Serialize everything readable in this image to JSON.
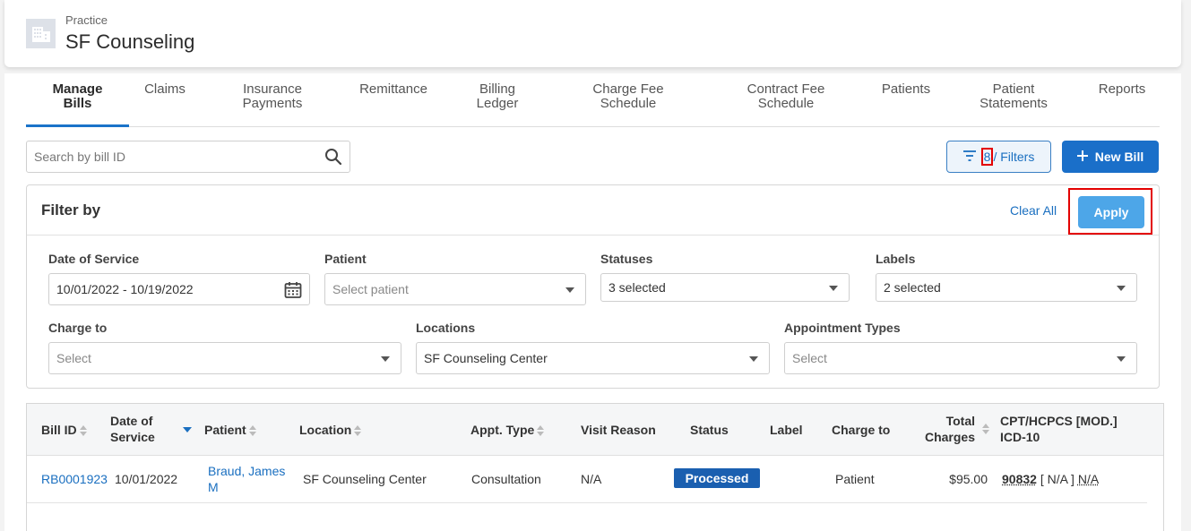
{
  "header": {
    "practice_label": "Practice",
    "practice_name": "SF Counseling"
  },
  "tabs": [
    {
      "line1": "Manage",
      "line2": "Bills"
    },
    {
      "line1": "Claims",
      "line2": ""
    },
    {
      "line1": "Insurance",
      "line2": "Payments"
    },
    {
      "line1": "Remittance",
      "line2": ""
    },
    {
      "line1": "Billing",
      "line2": "Ledger"
    },
    {
      "line1": "Charge Fee",
      "line2": "Schedule"
    },
    {
      "line1": "Contract Fee",
      "line2": "Schedule"
    },
    {
      "line1": "Patients",
      "line2": ""
    },
    {
      "line1": "Patient",
      "line2": "Statements"
    },
    {
      "line1": "Reports",
      "line2": ""
    }
  ],
  "search": {
    "placeholder": "Search by bill ID"
  },
  "toolbar": {
    "filter_count": "8",
    "filters_label": "/ Filters",
    "new_bill_label": "New Bill"
  },
  "filter_panel": {
    "title": "Filter by",
    "clear_all": "Clear All",
    "apply": "Apply",
    "date_of_service": {
      "label": "Date of Service",
      "value": "10/01/2022 - 10/19/2022"
    },
    "patient": {
      "label": "Patient",
      "value": "Select patient"
    },
    "statuses": {
      "label": "Statuses",
      "value": "3 selected"
    },
    "labels": {
      "label": "Labels",
      "value": "2 selected"
    },
    "charge_to": {
      "label": "Charge to",
      "value": "Select"
    },
    "locations": {
      "label": "Locations",
      "value": "SF Counseling Center"
    },
    "appointment_types": {
      "label": "Appointment Types",
      "value": "Select"
    }
  },
  "table": {
    "headers": {
      "bill_id": "Bill ID",
      "date_line1": "Date of",
      "date_line2": "Service",
      "patient": "Patient",
      "location": "Location",
      "appt_type": "Appt. Type",
      "visit_reason": "Visit Reason",
      "status": "Status",
      "label": "Label",
      "charge_to": "Charge to",
      "total_line1": "Total",
      "total_line2": "Charges",
      "cpt_line1": "CPT/HCPCS [MOD.]",
      "cpt_line2": "ICD-10"
    },
    "rows": [
      {
        "bill_id": "RB0001923",
        "date": "10/01/2022",
        "patient_line1": "Braud, James",
        "patient_line2": "M",
        "location": "SF Counseling Center",
        "appt_type": "Consultation",
        "visit_reason": "N/A",
        "status": "Processed",
        "label": "",
        "charge_to": "Patient",
        "total": "$95.00",
        "cpt_code": "90832",
        "cpt_mod": " [ N/A ] ",
        "icd": "N/A"
      }
    ]
  },
  "colors": {
    "primary": "#1a6fc9",
    "apply": "#4da6e8",
    "status_processed": "#1a5fb0",
    "highlight": "#e30000"
  }
}
